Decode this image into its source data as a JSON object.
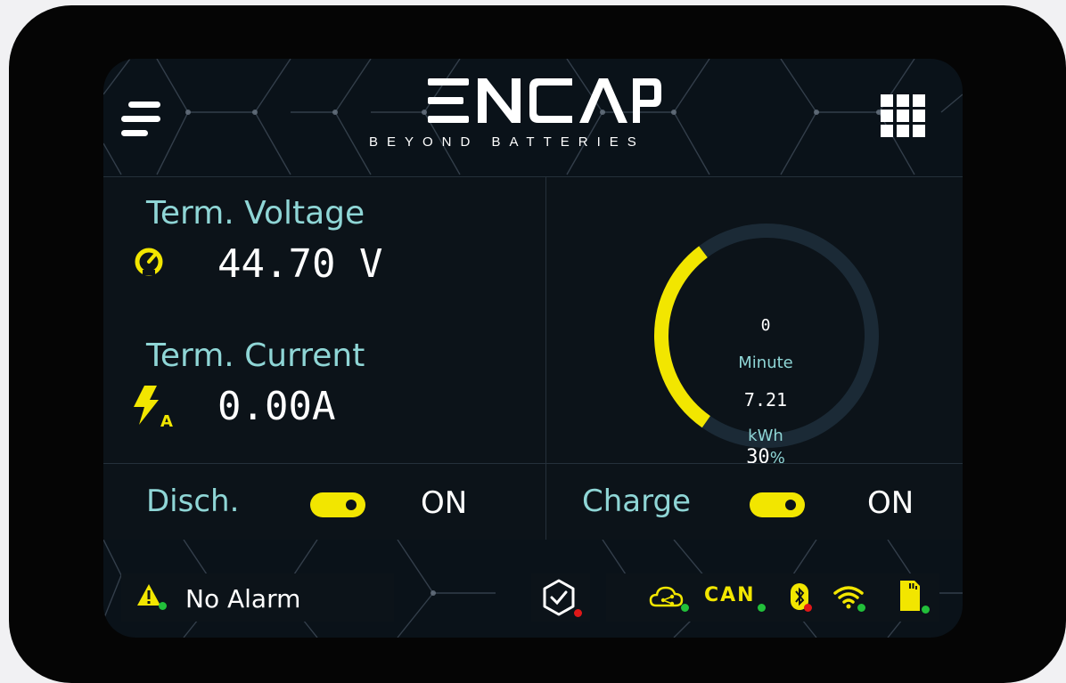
{
  "brand": {
    "logo": "ENCAP",
    "tagline": "BEYOND BATTERIES"
  },
  "voltage": {
    "label": "Term. Voltage",
    "value": "44.70 V"
  },
  "current": {
    "label": "Term. Current",
    "value": "0.00A"
  },
  "gauge": {
    "minutes": "0",
    "minutes_unit": "Minute",
    "energy": "7.21",
    "energy_unit": "kWh",
    "percent_value": "30",
    "percent_sign": "%",
    "fill_fraction": 0.3,
    "track_color": "#1b2a36",
    "fill_color": "#f2e600"
  },
  "discharge": {
    "label": "Disch.",
    "state": "ON"
  },
  "charge": {
    "label": "Charge",
    "state": "ON"
  },
  "alarm": {
    "text": "No Alarm"
  },
  "status_icons": {
    "can_label": "CAN"
  },
  "colors": {
    "accent_yellow": "#f2e600",
    "label_cyan": "#8fd6d6",
    "ok_green": "#22c03a",
    "err_red": "#e01818"
  }
}
